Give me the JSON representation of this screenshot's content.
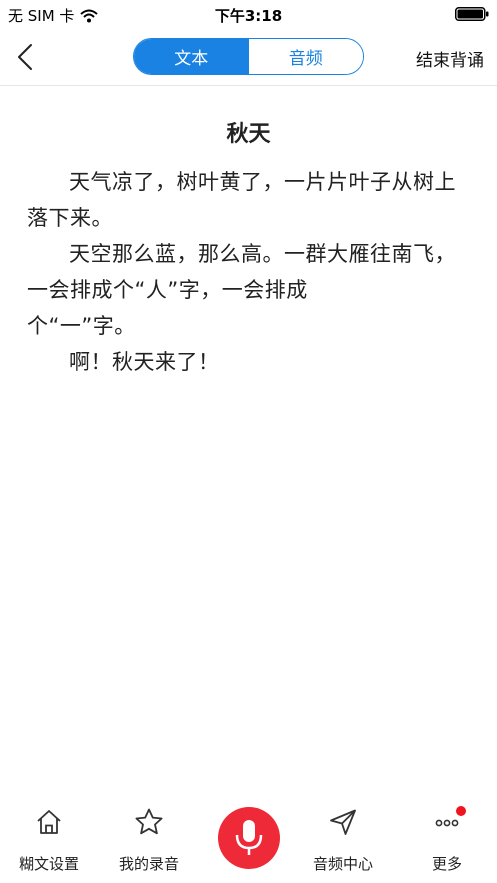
{
  "status_bar": {
    "carrier": "无 SIM 卡",
    "time": "下午3:18"
  },
  "nav": {
    "tabs": [
      {
        "label": "文本",
        "active": true
      },
      {
        "label": "音频",
        "active": false
      }
    ],
    "end_label": "结束背诵"
  },
  "article": {
    "title": "秋天",
    "paragraphs": [
      "天气凉了，树叶黄了，一片片叶子从树上落下来。",
      "天空那么蓝，那么高。一群大雁往南飞，一会排成个“人”字，一会排成",
      "个“一”字。",
      "啊！秋天来了！"
    ]
  },
  "toolbar": {
    "items": [
      {
        "label": "糊文设置",
        "icon": "home-icon"
      },
      {
        "label": "我的录音",
        "icon": "star-icon"
      },
      {
        "label": "",
        "icon": "microphone-icon"
      },
      {
        "label": "音频中心",
        "icon": "send-icon"
      },
      {
        "label": "更多",
        "icon": "more-icon",
        "has_badge": true
      }
    ]
  },
  "colors": {
    "accent": "#1a82e2",
    "mic": "#ee2a38",
    "badge": "#f0141e"
  }
}
